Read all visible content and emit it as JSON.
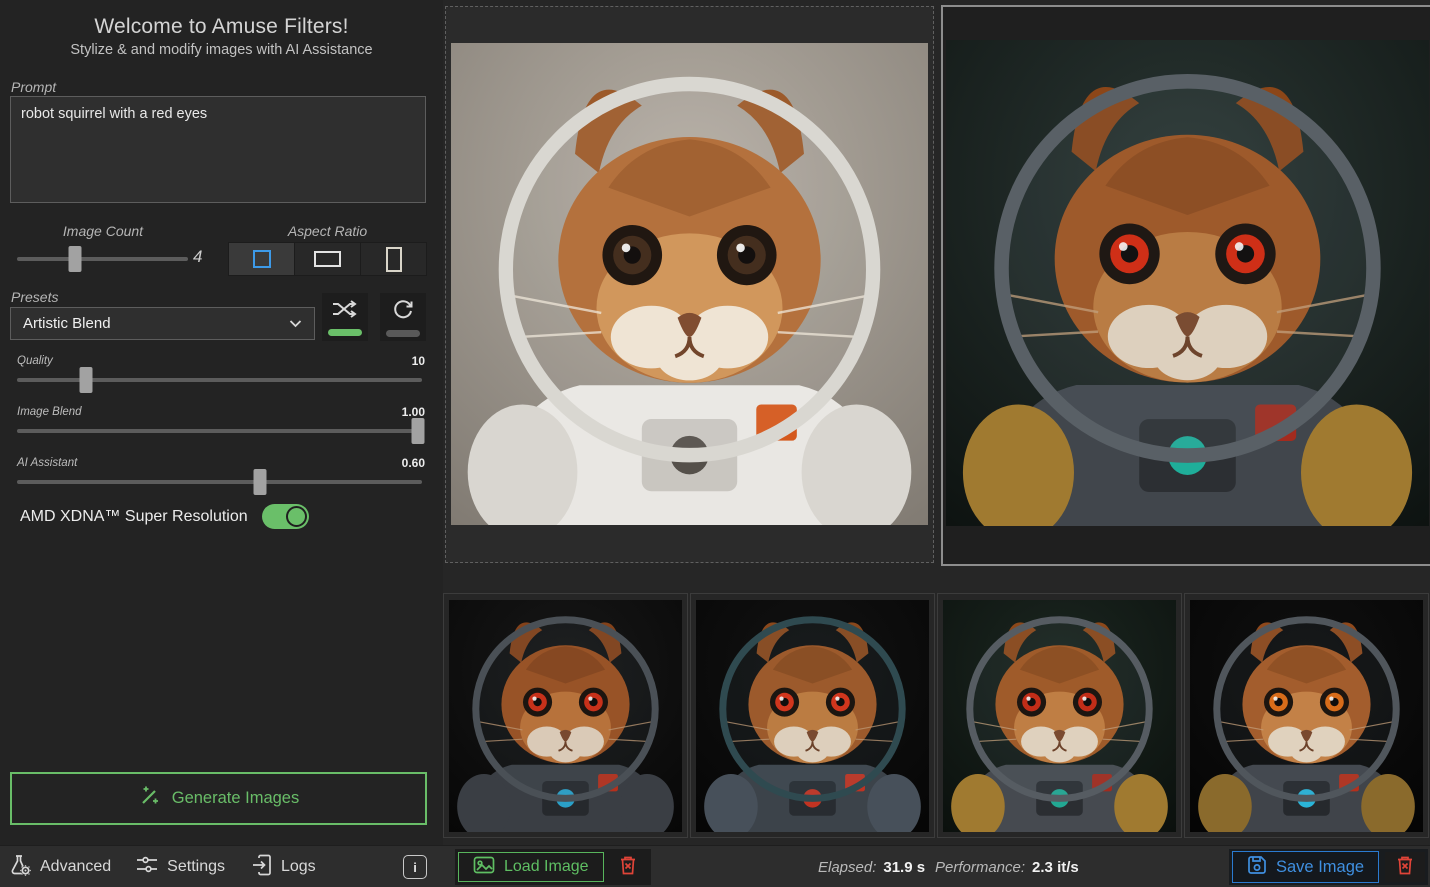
{
  "app": {
    "title": "Welcome to Amuse Filters!",
    "subtitle": "Stylize & and modify images with AI Assistance"
  },
  "prompt": {
    "label": "Prompt",
    "value": "robot squirrel with a red eyes"
  },
  "image_count": {
    "label": "Image Count",
    "value": "4",
    "pct": 34
  },
  "aspect_ratio": {
    "label": "Aspect Ratio",
    "selected": "square",
    "options": [
      "square-icon",
      "landscape-icon",
      "portrait-icon"
    ]
  },
  "presets": {
    "label": "Presets",
    "selected": "Artistic Blend"
  },
  "preset_actions": {
    "shuffle_enabled": true,
    "refresh_enabled": false
  },
  "sliders": [
    {
      "label": "Quality",
      "value": "10",
      "pct": 17
    },
    {
      "label": "Image Blend",
      "value": "1.00",
      "pct": 99
    },
    {
      "label": "AI Assistant",
      "value": "0.60",
      "pct": 60
    }
  ],
  "super_resolution": {
    "label": "AMD XDNA™ Super Resolution",
    "enabled": true
  },
  "generate": {
    "label": "Generate Images"
  },
  "footer": {
    "advanced": "Advanced",
    "settings": "Settings",
    "logs": "Logs",
    "info": "i"
  },
  "status": {
    "load_label": "Load Image",
    "elapsed_label": "Elapsed:",
    "elapsed_value": "31.9 s",
    "performance_label": "Performance:",
    "performance_value": "2.3 it/s",
    "save_label": "Save Image"
  },
  "colors": {
    "green": "#6abf69",
    "blue": "#3f8fe0",
    "red": "#e04438",
    "aspect_selected": "#3d9ae8"
  },
  "gallery": {
    "input": {
      "alt": "source photo: squirrel in white astronaut suit with clear helmet, brown eyes",
      "palette": {
        "bgTop": "#b6afa5",
        "bgBottom": "#7e7870",
        "fur": "#b06a33",
        "furLight": "#cf9254",
        "furDark": "#8a4a1e",
        "earOuter": "#9c5a2a",
        "muzzle": "#efe3d2",
        "eye": "#3a2312",
        "suit": "#e9e7e3",
        "arm": "#d9d6d0",
        "panel": "#c9c6c0",
        "lens": "#55504a",
        "patch": "#d4581c",
        "helmet": "#d9d7d1",
        "whisker": "#efe6d8",
        "glass": "rgba(255,255,255,0.05)"
      }
    },
    "output": {
      "alt": "generated: robot squirrel with red eyes in dark armored suit with gold arms",
      "palette": {
        "bgTop": "#2a3633",
        "bgBottom": "#0c110f",
        "fur": "#a2541f",
        "furLight": "#c07a3a",
        "furDark": "#7c3c12",
        "earOuter": "#8c4618",
        "muzzle": "#e8d7c2",
        "eye": "#d92408",
        "suit": "#41464c",
        "arm": "#a07a30",
        "panel": "#2c2f33",
        "lens": "#1fae9a",
        "patch": "#a32b1e",
        "helmet": "#596066",
        "whisker": "#caa27a",
        "glass": "rgba(130,150,160,0.10)"
      }
    },
    "thumbnails": [
      {
        "alt": "variation 1: red-eyed robot squirrel, gunmetal suit, cyan chest light",
        "palette": {
          "bgTop": "#171717",
          "bgBottom": "#060606",
          "fur": "#9c4f1e",
          "furLight": "#bd7034",
          "furDark": "#733812",
          "earOuter": "#84421a",
          "muzzle": "#e3d0ba",
          "eye": "#cf2a10",
          "suit": "#3a3e44",
          "arm": "#3a3e44",
          "panel": "#26292d",
          "lens": "#2aa0c8",
          "patch": "#b5301c",
          "helmet": "#4a5056",
          "whisker": "#c49a72",
          "glass": "rgba(120,140,150,0.08)"
        }
      },
      {
        "alt": "variation 2: red-eyed robot squirrel with teal helmet cap",
        "palette": {
          "bgTop": "#121212",
          "bgBottom": "#050505",
          "fur": "#a05522",
          "furLight": "#c27a3a",
          "furDark": "#7a3d14",
          "earOuter": "#8a481c",
          "muzzle": "#e6d4be",
          "eye": "#d92e12",
          "suit": "#3c434a",
          "arm": "#47505a",
          "panel": "#282c31",
          "lens": "#c23322",
          "patch": "#c03322",
          "helmet": "#2f4a50",
          "whisker": "#c49a72",
          "glass": "rgba(110,150,160,0.08)"
        }
      },
      {
        "alt": "variation 3: red-eyed robot squirrel, gold shoulder armor, green backdrop",
        "palette": {
          "bgTop": "#1b2620",
          "bgBottom": "#0a0f0c",
          "fur": "#a25620",
          "furLight": "#c57c3c",
          "furDark": "#7c3e12",
          "earOuter": "#8c481a",
          "muzzle": "#e8d6c0",
          "eye": "#c8240c",
          "suit": "#464a50",
          "arm": "#a07a30",
          "panel": "#2b2e32",
          "lens": "#22a893",
          "patch": "#a32b1e",
          "helmet": "#565c62",
          "whisker": "#c8a078",
          "glass": "rgba(130,150,160,0.08)"
        }
      },
      {
        "alt": "variation 4: orange-eyed robot squirrel, close crop, cyan chest light",
        "palette": {
          "bgTop": "#101010",
          "bgBottom": "#040404",
          "fur": "#a85a24",
          "furLight": "#ca8040",
          "furDark": "#7e4014",
          "earOuter": "#90491c",
          "muzzle": "#ead8c2",
          "eye": "#e06a10",
          "suit": "#40444a",
          "arm": "#8a6a2c",
          "panel": "#26292d",
          "lens": "#2ab4d8",
          "patch": "#b5301c",
          "helmet": "#50565c",
          "whisker": "#caa078",
          "glass": "rgba(120,140,150,0.08)"
        }
      }
    ]
  }
}
